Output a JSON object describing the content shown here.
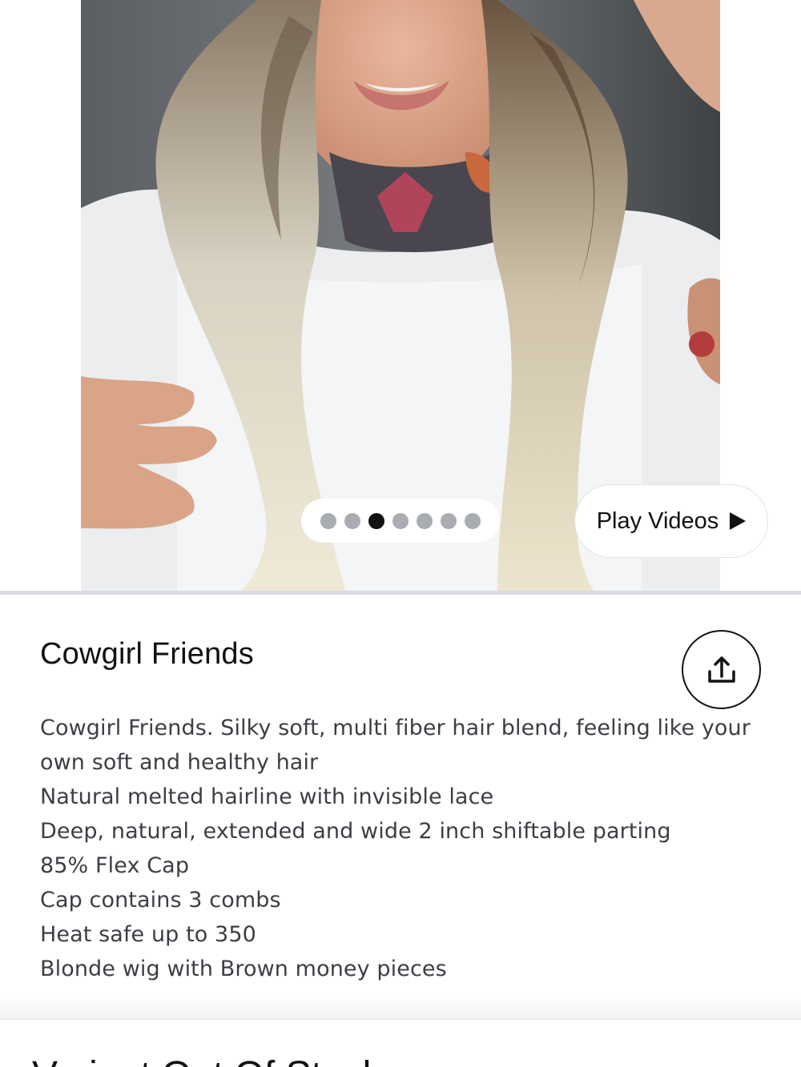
{
  "gallery": {
    "total_images": 7,
    "active_index": 2,
    "play_videos_label": "Play Videos"
  },
  "product": {
    "title": "Cowgirl Friends",
    "description_lines": [
      "Cowgirl Friends. Silky soft, multi fiber hair blend, feeling like your own soft and healthy hair",
      "Natural melted hairline with invisible lace",
      "Deep, natural, extended and wide 2 inch shiftable parting",
      "85% Flex Cap",
      "Cap contains 3 combs",
      "Heat safe up to 350",
      "Blonde wig with Brown money pieces"
    ]
  },
  "next_section": {
    "title": "Variant Out Of Stock"
  },
  "icons": {
    "share": "share-upload-icon",
    "play": "play-triangle-icon"
  },
  "colors": {
    "dot_active": "#111111",
    "dot_inactive": "#a9acb1",
    "text_primary": "#111111",
    "text_body": "#3b3f44"
  }
}
